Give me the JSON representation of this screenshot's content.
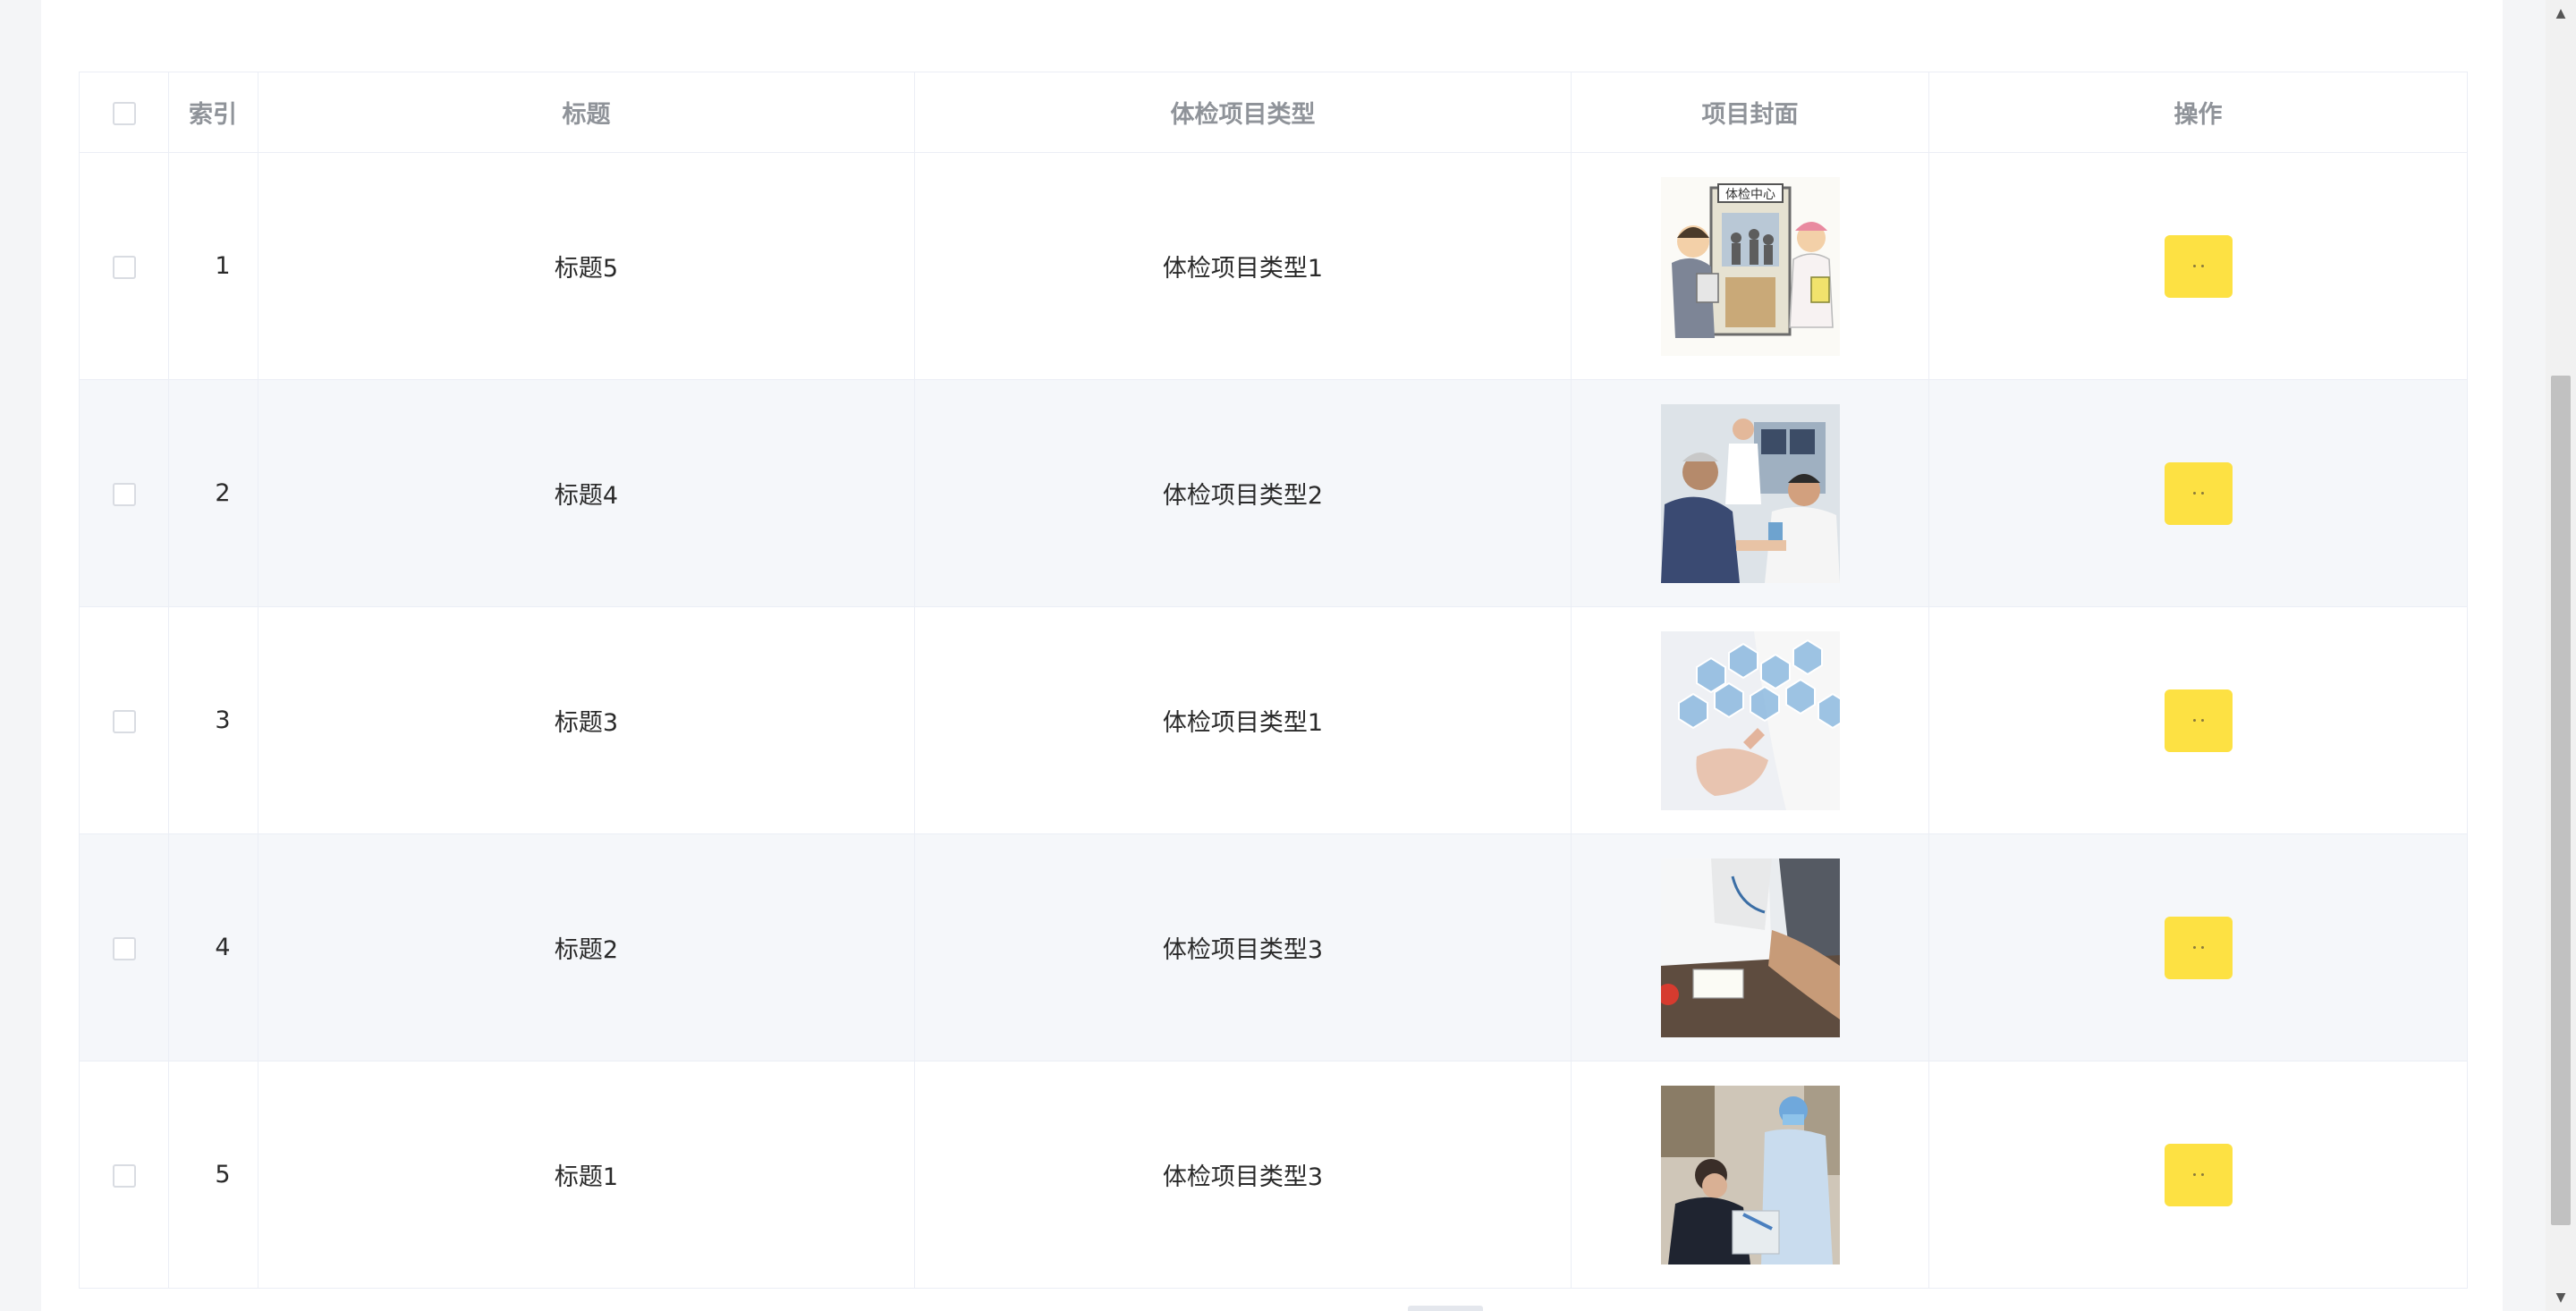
{
  "table": {
    "headers": {
      "select": "",
      "index": "索引",
      "title": "标题",
      "type": "体检项目类型",
      "cover": "项目封面",
      "ops": "操作"
    },
    "rows": [
      {
        "index": "1",
        "title": "标题5",
        "type": "体检项目类型1",
        "cover_icon": "checkup-cartoon-image"
      },
      {
        "index": "2",
        "title": "标题4",
        "type": "体检项目类型2",
        "cover_icon": "doctor-patient-image"
      },
      {
        "index": "3",
        "title": "标题3",
        "type": "体检项目类型1",
        "cover_icon": "medical-hexagon-image"
      },
      {
        "index": "4",
        "title": "标题2",
        "type": "体检项目类型3",
        "cover_icon": "blood-pressure-image"
      },
      {
        "index": "5",
        "title": "标题1",
        "type": "体检项目类型3",
        "cover_icon": "blood-draw-image"
      }
    ]
  },
  "colors": {
    "action_button": "#fde143",
    "stripe": "#f5f7fa",
    "border": "#ebeef5",
    "header_text": "#8f9399"
  }
}
